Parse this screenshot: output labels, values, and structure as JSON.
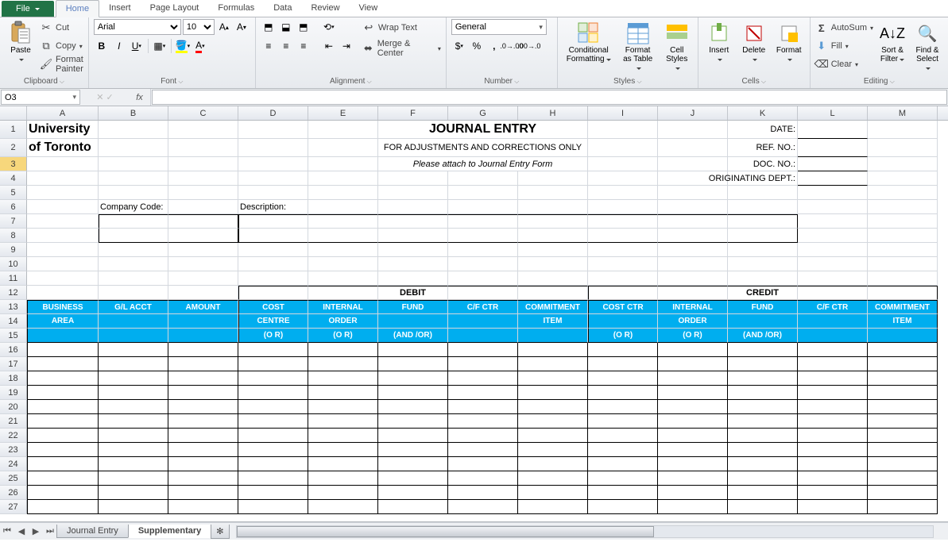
{
  "tabs": {
    "file": "File",
    "home": "Home",
    "insert": "Insert",
    "pageLayout": "Page Layout",
    "formulas": "Formulas",
    "data": "Data",
    "review": "Review",
    "view": "View"
  },
  "clipboard": {
    "paste": "Paste",
    "cut": "Cut",
    "copy": "Copy",
    "painter": "Format Painter",
    "group": "Clipboard"
  },
  "font": {
    "name": "Arial",
    "size": "10",
    "group": "Font"
  },
  "alignment": {
    "wrap": "Wrap Text",
    "merge": "Merge & Center",
    "group": "Alignment"
  },
  "number": {
    "format": "General",
    "group": "Number"
  },
  "styles": {
    "cond": "Conditional Formatting",
    "table": "Format as Table",
    "cell": "Cell Styles",
    "group": "Styles"
  },
  "cells": {
    "insert": "Insert",
    "delete": "Delete",
    "format": "Format",
    "group": "Cells"
  },
  "editing": {
    "autosum": "AutoSum",
    "fill": "Fill",
    "clear": "Clear",
    "sort": "Sort & Filter",
    "find": "Find & Select",
    "group": "Editing"
  },
  "nameBox": "O3",
  "fx": "fx",
  "cols": [
    "A",
    "B",
    "C",
    "D",
    "E",
    "F",
    "G",
    "H",
    "I",
    "J",
    "K",
    "L",
    "M"
  ],
  "sheet": {
    "a1": "University",
    "a2": "of Toronto",
    "title": "JOURNAL ENTRY",
    "sub1": "FOR ADJUSTMENTS AND CORRECTIONS ONLY",
    "sub2": "Please attach to Journal Entry Form",
    "date": "DATE:",
    "ref": "REF. NO.:",
    "doc": "DOC. NO.:",
    "orig": "ORIGINATING DEPT.:",
    "company": "Company Code:",
    "desc": "Description:",
    "debit": "DEBIT",
    "credit": "CREDIT",
    "h": {
      "ba1": "BUSINESS",
      "ba2": "AREA",
      "gl": "G/L ACCT",
      "amt": "AMOUNT",
      "cc1": "COST",
      "cc2": "CENTRE",
      "io1": "INTERNAL",
      "io2": "ORDER",
      "fund": "FUND",
      "cfctr": "C/F CTR",
      "ci1": "COMMITMENT",
      "ci2": "ITEM",
      "costctr": "COST CTR",
      "or": "(O R)",
      "andor": "(AND /OR)"
    }
  },
  "sheets": {
    "s1": "Journal Entry",
    "s2": "Supplementary"
  }
}
